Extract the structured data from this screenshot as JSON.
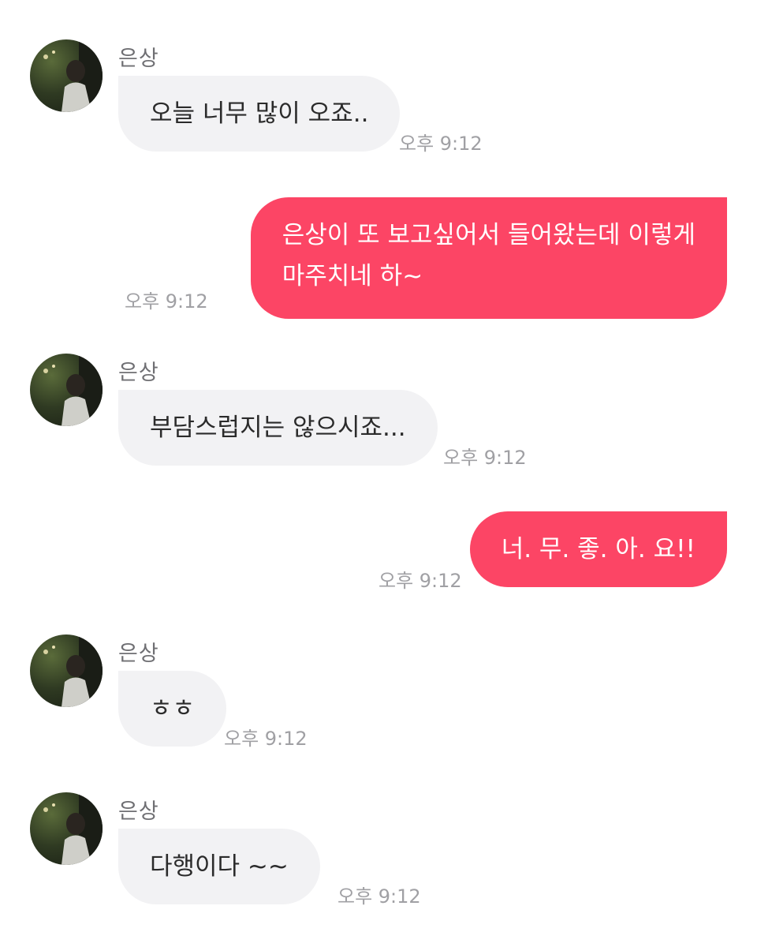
{
  "messages": [
    {
      "direction": "incoming",
      "sender": "은상",
      "text": "오늘 너무 많이 오죠..",
      "time": "오후 9:12"
    },
    {
      "direction": "outgoing",
      "lines": [
        "은상이 또 보고싶어서 들어왔는데 이렇게",
        "마주치네 하~"
      ],
      "time": "오후 9:12"
    },
    {
      "direction": "incoming",
      "sender": "은상",
      "text": "부담스럽지는 않으시죠...",
      "time": "오후 9:12"
    },
    {
      "direction": "outgoing",
      "text": "너. 무. 좋. 아. 요!!",
      "time": "오후 9:12"
    },
    {
      "direction": "incoming",
      "sender": "은상",
      "text": "ㅎㅎ",
      "time": "오후 9:12"
    },
    {
      "direction": "incoming",
      "sender": "은상",
      "text": "다행이다 ~~",
      "time": "오후 9:12"
    }
  ],
  "colors": {
    "incoming_bubble": "#f2f2f4",
    "outgoing_bubble": "#fc4565",
    "timestamp": "#a0a0a4",
    "sender_name": "#6f6f73"
  },
  "icons": {
    "avatar": "profile-photo-avatar"
  }
}
